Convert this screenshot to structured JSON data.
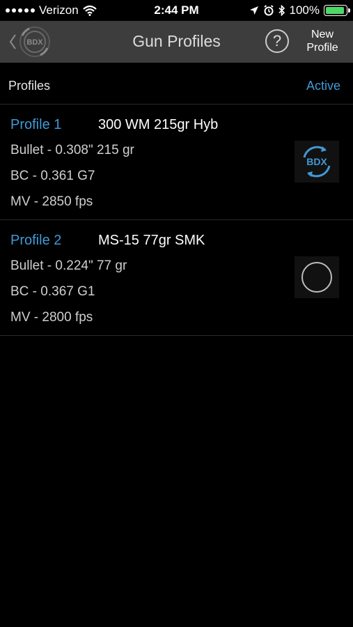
{
  "status_bar": {
    "carrier": "Verizon",
    "time": "2:44 PM",
    "battery_percent": "100%",
    "battery_level": 1.0
  },
  "nav": {
    "back_logo_text": "BDX",
    "title": "Gun Profiles",
    "help_label": "?",
    "new_profile_line1": "New",
    "new_profile_line2": "Profile"
  },
  "list_header": {
    "left": "Profiles",
    "right": "Active"
  },
  "profiles": [
    {
      "name": "Profile 1",
      "title": "300 WM 215gr Hyb",
      "bullet": "Bullet - 0.308\" 215 gr",
      "bc": "BC - 0.361  G7",
      "mv": "MV - 2850  fps",
      "active": true,
      "indicator_text": "BDX"
    },
    {
      "name": "Profile 2",
      "title": "MS-15 77gr SMK",
      "bullet": "Bullet - 0.224\" 77 gr",
      "bc": "BC - 0.367  G1",
      "mv": "MV - 2800  fps",
      "active": false
    }
  ],
  "colors": {
    "accent": "#3f9ad6",
    "nav_bg": "#3d3d3d",
    "battery": "#4cd964"
  }
}
